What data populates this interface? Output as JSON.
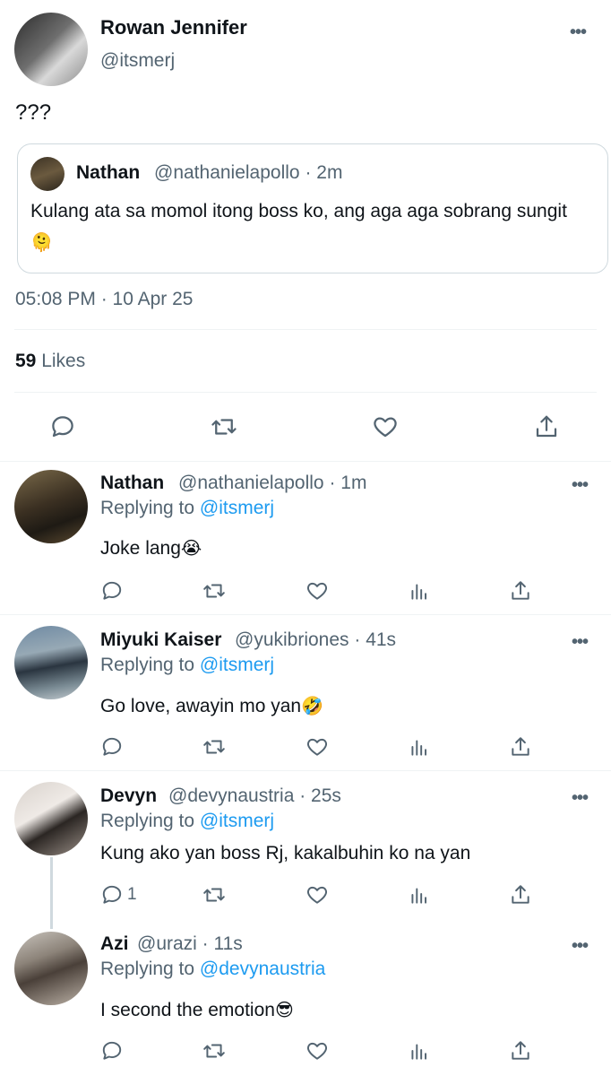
{
  "main_tweet": {
    "author_name": "Rowan Jennifer",
    "handle": "@itsmerj",
    "text": "???",
    "quote": {
      "author_name": "Nathan",
      "meta": "@nathanielapollo · 2m",
      "text": "Kulang ata sa momol itong boss ko, ang aga aga sobrang sungit",
      "emoji": "🫠"
    },
    "timestamp": "05:08 PM · 10 Apr 25",
    "likes_count": "59",
    "likes_label": "Likes"
  },
  "more_icon": "•••",
  "replies": [
    {
      "name": "Nathan",
      "meta": "@nathanielapollo · 1m",
      "replying_prefix": "Replying to ",
      "replying_to": "@itsmerj",
      "text": "Joke lang",
      "emoji": "😭",
      "reply_count": ""
    },
    {
      "name": "Miyuki Kaiser",
      "meta": "@yukibriones · 41s",
      "replying_prefix": "Replying to ",
      "replying_to": "@itsmerj",
      "text": "Go love, awayin mo yan",
      "emoji": "🤣",
      "reply_count": ""
    },
    {
      "name": "Devyn",
      "meta": "@devynaustria · 25s",
      "replying_prefix": "Replying to ",
      "replying_to": "@itsmerj",
      "text": "Kung ako yan boss Rj, kakalbuhin ko na yan",
      "emoji": "",
      "reply_count": "1"
    },
    {
      "name": "Azi",
      "meta": "@urazi · 11s",
      "replying_prefix": "Replying to ",
      "replying_to": "@devynaustria",
      "text": "I second the emotion",
      "emoji": "😎",
      "reply_count": ""
    }
  ],
  "colors": {
    "text": "#0f1419",
    "secondary": "#536471",
    "link": "#1d9bf0",
    "border": "#cfd9de",
    "divider": "#eff3f4"
  }
}
